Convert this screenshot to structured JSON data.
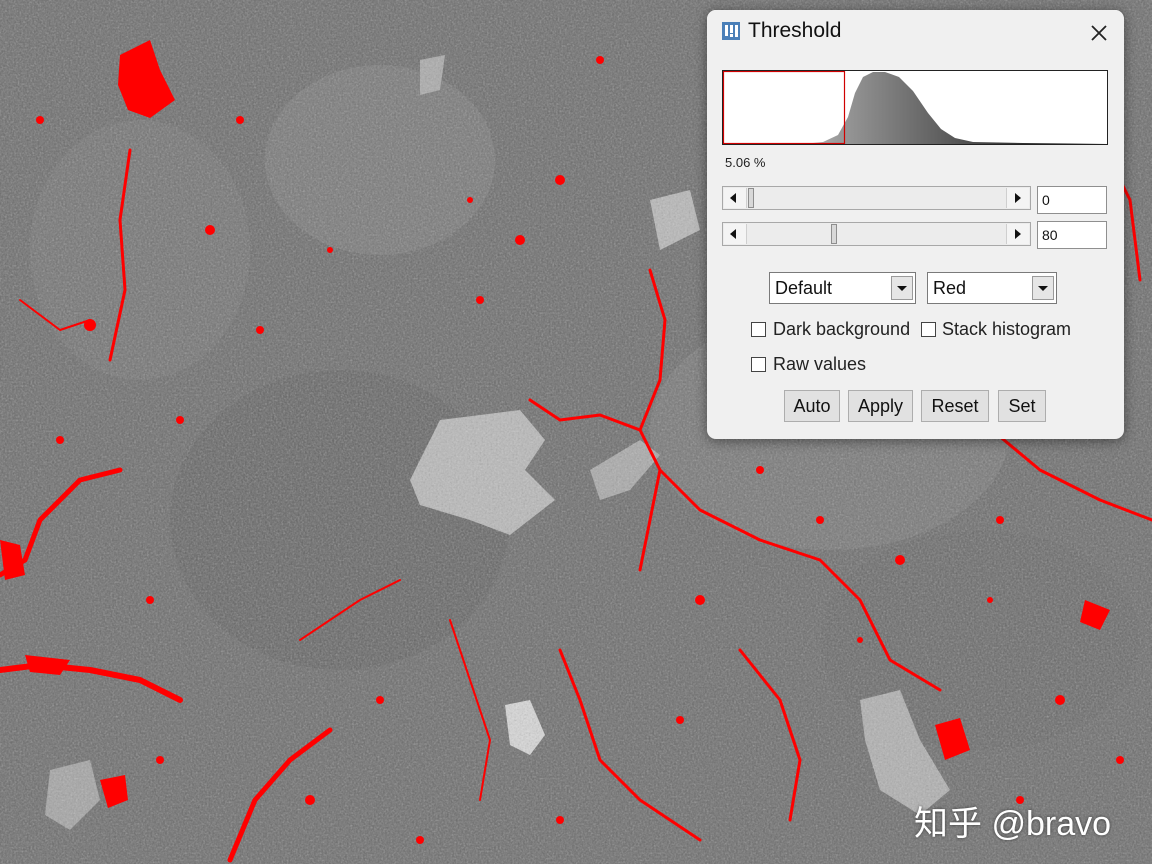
{
  "dialog": {
    "title": "Threshold",
    "app_icon": "imagej-icon",
    "percent_label": "5.06 %",
    "min_value": "0",
    "max_value": "80",
    "method_select": "Default",
    "display_select": "Red",
    "checkboxes": {
      "dark_background": "Dark background",
      "stack_histogram": "Stack histogram",
      "raw_values": "Raw values"
    },
    "buttons": {
      "auto": "Auto",
      "apply": "Apply",
      "reset": "Reset",
      "set": "Set"
    }
  },
  "colors": {
    "threshold_overlay": "#ff0000",
    "dialog_bg": "#f0f0f0"
  },
  "watermark": "知乎 @bravo"
}
